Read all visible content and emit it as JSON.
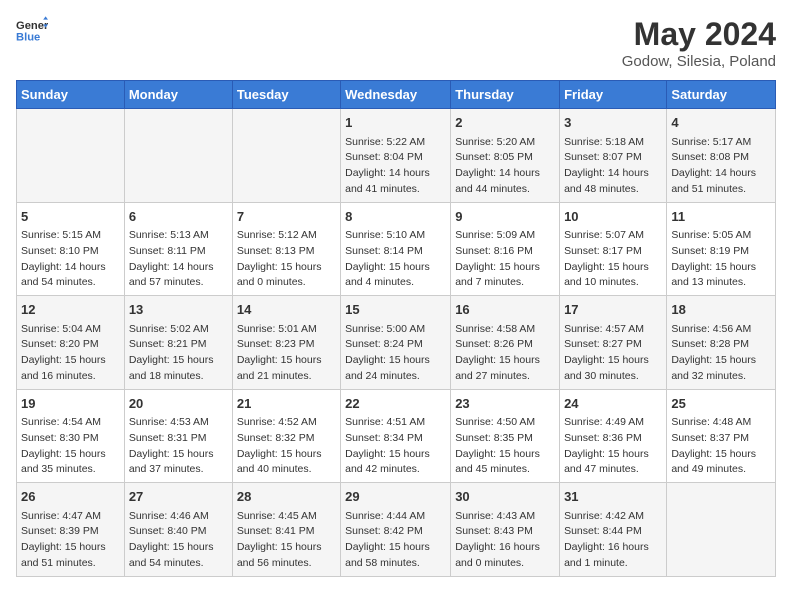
{
  "header": {
    "logo_general": "General",
    "logo_blue": "Blue",
    "month": "May 2024",
    "location": "Godow, Silesia, Poland"
  },
  "days_of_week": [
    "Sunday",
    "Monday",
    "Tuesday",
    "Wednesday",
    "Thursday",
    "Friday",
    "Saturday"
  ],
  "weeks": [
    [
      {
        "num": "",
        "info": ""
      },
      {
        "num": "",
        "info": ""
      },
      {
        "num": "",
        "info": ""
      },
      {
        "num": "1",
        "info": "Sunrise: 5:22 AM\nSunset: 8:04 PM\nDaylight: 14 hours and 41 minutes."
      },
      {
        "num": "2",
        "info": "Sunrise: 5:20 AM\nSunset: 8:05 PM\nDaylight: 14 hours and 44 minutes."
      },
      {
        "num": "3",
        "info": "Sunrise: 5:18 AM\nSunset: 8:07 PM\nDaylight: 14 hours and 48 minutes."
      },
      {
        "num": "4",
        "info": "Sunrise: 5:17 AM\nSunset: 8:08 PM\nDaylight: 14 hours and 51 minutes."
      }
    ],
    [
      {
        "num": "5",
        "info": "Sunrise: 5:15 AM\nSunset: 8:10 PM\nDaylight: 14 hours and 54 minutes."
      },
      {
        "num": "6",
        "info": "Sunrise: 5:13 AM\nSunset: 8:11 PM\nDaylight: 14 hours and 57 minutes."
      },
      {
        "num": "7",
        "info": "Sunrise: 5:12 AM\nSunset: 8:13 PM\nDaylight: 15 hours and 0 minutes."
      },
      {
        "num": "8",
        "info": "Sunrise: 5:10 AM\nSunset: 8:14 PM\nDaylight: 15 hours and 4 minutes."
      },
      {
        "num": "9",
        "info": "Sunrise: 5:09 AM\nSunset: 8:16 PM\nDaylight: 15 hours and 7 minutes."
      },
      {
        "num": "10",
        "info": "Sunrise: 5:07 AM\nSunset: 8:17 PM\nDaylight: 15 hours and 10 minutes."
      },
      {
        "num": "11",
        "info": "Sunrise: 5:05 AM\nSunset: 8:19 PM\nDaylight: 15 hours and 13 minutes."
      }
    ],
    [
      {
        "num": "12",
        "info": "Sunrise: 5:04 AM\nSunset: 8:20 PM\nDaylight: 15 hours and 16 minutes."
      },
      {
        "num": "13",
        "info": "Sunrise: 5:02 AM\nSunset: 8:21 PM\nDaylight: 15 hours and 18 minutes."
      },
      {
        "num": "14",
        "info": "Sunrise: 5:01 AM\nSunset: 8:23 PM\nDaylight: 15 hours and 21 minutes."
      },
      {
        "num": "15",
        "info": "Sunrise: 5:00 AM\nSunset: 8:24 PM\nDaylight: 15 hours and 24 minutes."
      },
      {
        "num": "16",
        "info": "Sunrise: 4:58 AM\nSunset: 8:26 PM\nDaylight: 15 hours and 27 minutes."
      },
      {
        "num": "17",
        "info": "Sunrise: 4:57 AM\nSunset: 8:27 PM\nDaylight: 15 hours and 30 minutes."
      },
      {
        "num": "18",
        "info": "Sunrise: 4:56 AM\nSunset: 8:28 PM\nDaylight: 15 hours and 32 minutes."
      }
    ],
    [
      {
        "num": "19",
        "info": "Sunrise: 4:54 AM\nSunset: 8:30 PM\nDaylight: 15 hours and 35 minutes."
      },
      {
        "num": "20",
        "info": "Sunrise: 4:53 AM\nSunset: 8:31 PM\nDaylight: 15 hours and 37 minutes."
      },
      {
        "num": "21",
        "info": "Sunrise: 4:52 AM\nSunset: 8:32 PM\nDaylight: 15 hours and 40 minutes."
      },
      {
        "num": "22",
        "info": "Sunrise: 4:51 AM\nSunset: 8:34 PM\nDaylight: 15 hours and 42 minutes."
      },
      {
        "num": "23",
        "info": "Sunrise: 4:50 AM\nSunset: 8:35 PM\nDaylight: 15 hours and 45 minutes."
      },
      {
        "num": "24",
        "info": "Sunrise: 4:49 AM\nSunset: 8:36 PM\nDaylight: 15 hours and 47 minutes."
      },
      {
        "num": "25",
        "info": "Sunrise: 4:48 AM\nSunset: 8:37 PM\nDaylight: 15 hours and 49 minutes."
      }
    ],
    [
      {
        "num": "26",
        "info": "Sunrise: 4:47 AM\nSunset: 8:39 PM\nDaylight: 15 hours and 51 minutes."
      },
      {
        "num": "27",
        "info": "Sunrise: 4:46 AM\nSunset: 8:40 PM\nDaylight: 15 hours and 54 minutes."
      },
      {
        "num": "28",
        "info": "Sunrise: 4:45 AM\nSunset: 8:41 PM\nDaylight: 15 hours and 56 minutes."
      },
      {
        "num": "29",
        "info": "Sunrise: 4:44 AM\nSunset: 8:42 PM\nDaylight: 15 hours and 58 minutes."
      },
      {
        "num": "30",
        "info": "Sunrise: 4:43 AM\nSunset: 8:43 PM\nDaylight: 16 hours and 0 minutes."
      },
      {
        "num": "31",
        "info": "Sunrise: 4:42 AM\nSunset: 8:44 PM\nDaylight: 16 hours and 1 minute."
      },
      {
        "num": "",
        "info": ""
      }
    ]
  ]
}
